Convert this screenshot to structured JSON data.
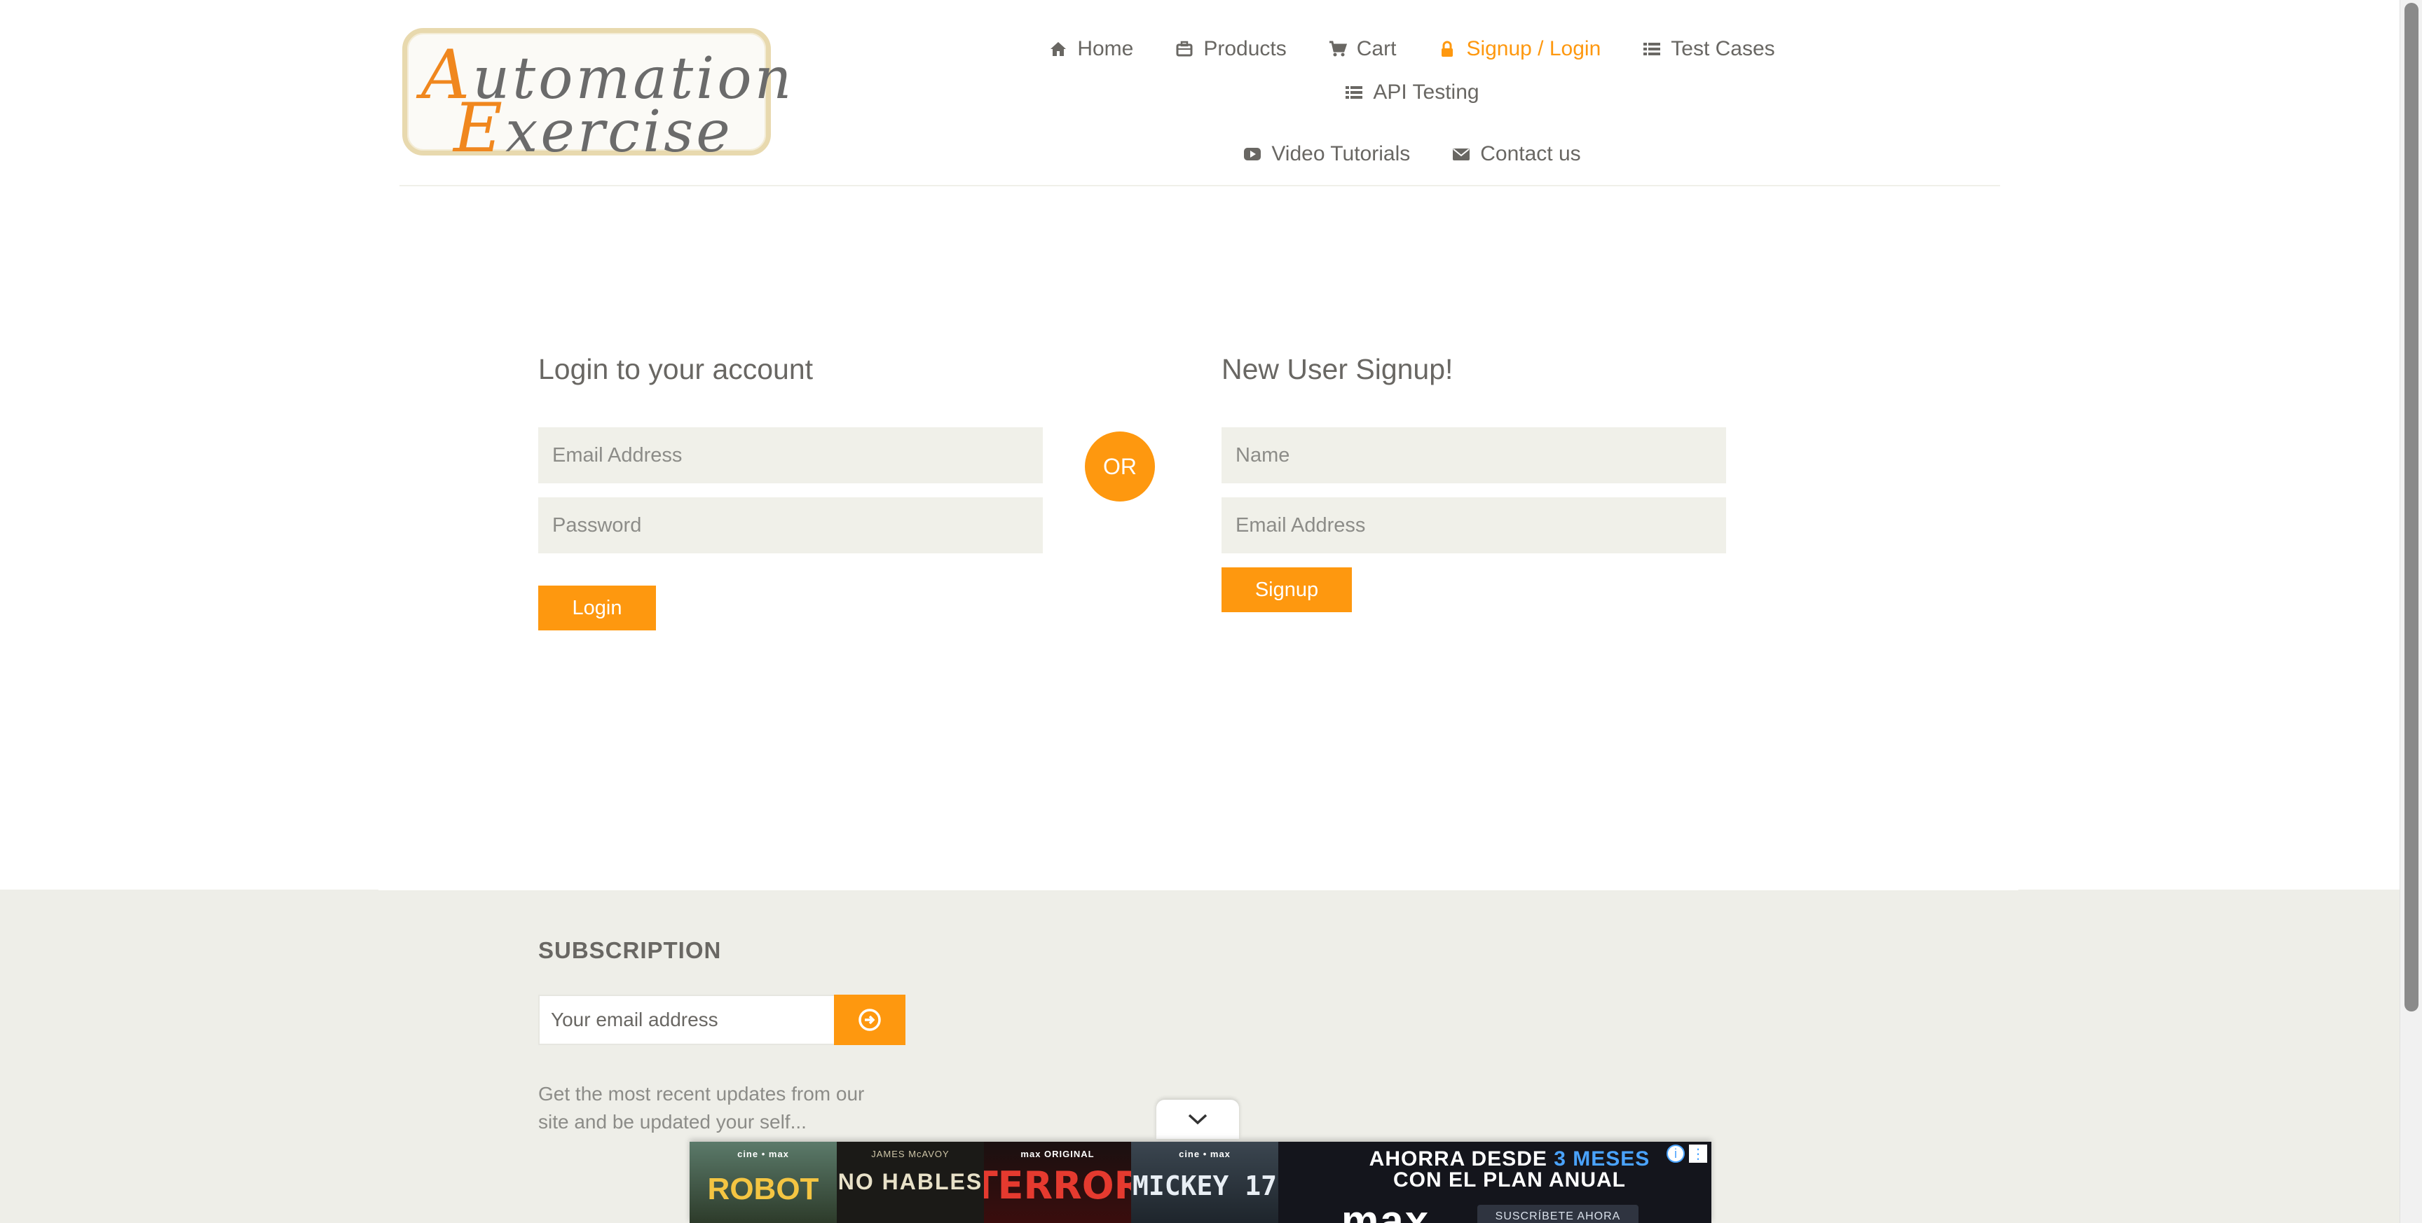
{
  "logo": {
    "line1_cap": "A",
    "line1_rest": "utomation",
    "line2_cap": "E",
    "line2_rest": "xercise"
  },
  "nav": {
    "items": [
      {
        "label": "Home",
        "icon": "home-icon"
      },
      {
        "label": "Products",
        "icon": "products-icon"
      },
      {
        "label": "Cart",
        "icon": "cart-icon"
      },
      {
        "label": "Signup / Login",
        "icon": "lock-icon",
        "active": true
      },
      {
        "label": "Test Cases",
        "icon": "list-icon"
      },
      {
        "label": "API Testing",
        "icon": "list-icon"
      },
      {
        "label": "Video Tutorials",
        "icon": "youtube-icon"
      },
      {
        "label": "Contact us",
        "icon": "envelope-icon"
      }
    ]
  },
  "login": {
    "title": "Login to your account",
    "email_placeholder": "Email Address",
    "password_placeholder": "Password",
    "button": "Login"
  },
  "or_label": "OR",
  "signup": {
    "title": "New User Signup!",
    "name_placeholder": "Name",
    "email_placeholder": "Email Address",
    "button": "Signup"
  },
  "footer": {
    "subscription_title": "SUBSCRIPTION",
    "email_placeholder": "Your email address",
    "description": "Get the most recent updates from our site and be updated your self..."
  },
  "ad": {
    "posters": [
      {
        "brand": "cine • max",
        "title": "ROBOT"
      },
      {
        "brand": "JAMES McAVOY",
        "title": "NO HABLES"
      },
      {
        "brand": "max ORIGINAL",
        "title": "TERROR"
      },
      {
        "brand": "cine • max",
        "title": "MICKEY 17"
      }
    ],
    "headline_part1": "AHORRA DESDE ",
    "headline_highlight": "3 MESES",
    "headline_line2": "CON EL PLAN ANUAL",
    "brand": "max",
    "cta": "SUSCRÍBETE AHORA"
  },
  "colors": {
    "accent": "#fe980f",
    "text": "#696763",
    "field_bg": "#f0f0e9",
    "footer_bg": "#eeeee8"
  }
}
